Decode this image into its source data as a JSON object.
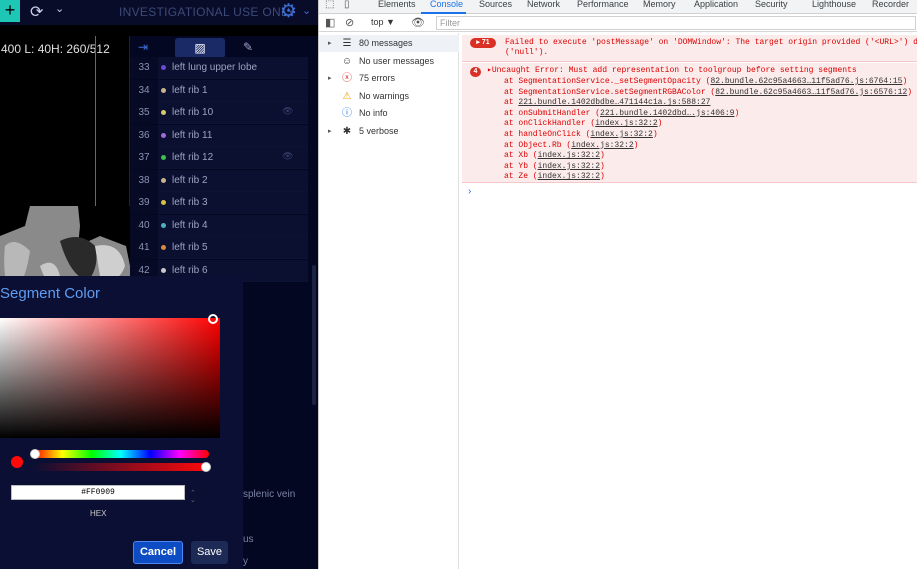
{
  "app": {
    "banner": "INVESTIGATIONAL USE ONLY",
    "viewport_overlay": "400  L: 40H: 260/512",
    "segments": [
      {
        "num": "33",
        "label": "left lung upper lobe",
        "color": "#6a4bd8",
        "eye": ""
      },
      {
        "num": "34",
        "label": "left rib 1",
        "color": "#c9b48a",
        "eye": ""
      },
      {
        "num": "35",
        "label": "left rib 10",
        "color": "#d8c96a",
        "eye": "👁"
      },
      {
        "num": "36",
        "label": "left rib 11",
        "color": "#a06ad8",
        "eye": ""
      },
      {
        "num": "37",
        "label": "left rib 12",
        "color": "#3cc04a",
        "eye": "👁"
      },
      {
        "num": "38",
        "label": "left rib 2",
        "color": "#c9b48a",
        "eye": ""
      },
      {
        "num": "39",
        "label": "left rib 3",
        "color": "#d8c040",
        "eye": ""
      },
      {
        "num": "40",
        "label": "left rib 4",
        "color": "#4bb0c0",
        "eye": ""
      },
      {
        "num": "41",
        "label": "left rib 5",
        "color": "#d88a40",
        "eye": ""
      },
      {
        "num": "42",
        "label": "left rib 6",
        "color": "#c9c9c9",
        "eye": ""
      }
    ],
    "bleed": {
      "a": "r",
      "b": "splenic vein",
      "c": "us",
      "d": "y"
    }
  },
  "picker": {
    "title": "Segment Color",
    "hex_value": "#FF0909",
    "hex_label": "HEX",
    "cancel_label": "Cancel",
    "save_label": "Save",
    "color": "#ff0909"
  },
  "devtools": {
    "tabs": [
      "Elements",
      "Console",
      "Sources",
      "Network",
      "Performance",
      "Memory",
      "Application",
      "Security",
      "Lighthouse",
      "Recorder"
    ],
    "context": "top ▼",
    "filter_placeholder": "Filter",
    "sidebar": [
      {
        "label": "80 messages",
        "icon": "☰",
        "arrow": "▸"
      },
      {
        "label": "No user messages",
        "icon": "☺",
        "arrow": ""
      },
      {
        "label": "75 errors",
        "icon": "ⓧ",
        "arrow": "▸"
      },
      {
        "label": "No warnings",
        "icon": "⚠",
        "arrow": ""
      },
      {
        "label": "No info",
        "icon": "ⓘ",
        "arrow": ""
      },
      {
        "label": "5 verbose",
        "icon": "✱",
        "arrow": "▸"
      }
    ],
    "msg1": {
      "count": "71",
      "line1": "Failed to execute 'postMessage' on 'DOMWindow': The target origin provided ('<URL>') d",
      "line2": "('null')."
    },
    "msg2": {
      "count": "4",
      "header": "▸Uncaught Error: Must add representation to toolgroup before setting segments",
      "frames": [
        {
          "fn": "at SegmentationService._setSegmentOpacity (",
          "link": "82.bundle.62c95a4663…11f5ad76.js:6764:15",
          "end": ")"
        },
        {
          "fn": "at SegmentationService.setSegmentRGBAColor (",
          "link": "82.bundle.62c95a4663…11f5ad76.js:6576:12",
          "end": ")"
        },
        {
          "fn": "at ",
          "link": "221.bundle.1402dbdbe…471144c1a.js:588:27",
          "end": ""
        },
        {
          "fn": "at onSubmitHandler (",
          "link": "221.bundle.1402dbd….js:406:9",
          "end": ")"
        },
        {
          "fn": "at onClickHandler (",
          "link": "index.js:32:2",
          "end": ")"
        },
        {
          "fn": "at handleOnClick (",
          "link": "index.js:32:2",
          "end": ")"
        },
        {
          "fn": "at Object.Rb (",
          "link": "index.js:32:2",
          "end": ")"
        },
        {
          "fn": "at Xb (",
          "link": "index.js:32:2",
          "end": ")"
        },
        {
          "fn": "at Yb (",
          "link": "index.js:32:2",
          "end": ")"
        },
        {
          "fn": "at Ze (",
          "link": "index.js:32:2",
          "end": ")"
        }
      ]
    },
    "prompt": "›"
  }
}
